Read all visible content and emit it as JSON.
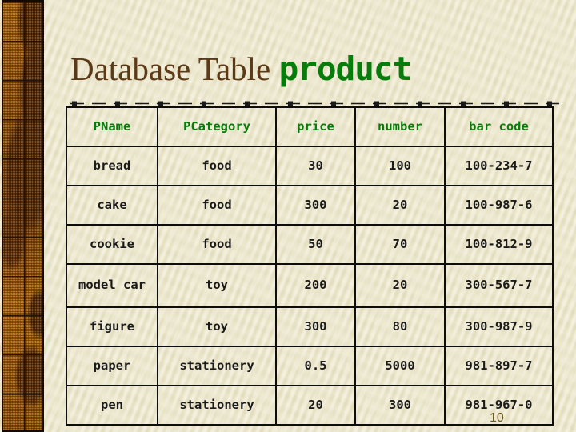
{
  "slide": {
    "background_color": "#efead0",
    "page_number": "10"
  },
  "decoration": {
    "left_band_name": "textured-brown-border",
    "band_colors": [
      "#a9661d",
      "#4a2a16",
      "#120b04"
    ],
    "dashed_rule_color": "#1a1a1a"
  },
  "title": {
    "prefix": "Database Table ",
    "entity": "product",
    "prefix_color": "#5c3a17",
    "entity_color": "#067d0b"
  },
  "table": {
    "header_color": "#067d0b",
    "body_color": "#1a1a1a",
    "border_color": "#0d0d0d",
    "columns": [
      "PName",
      "PCategory",
      "price",
      "number",
      "bar code"
    ],
    "rows": [
      [
        "bread",
        "food",
        "30",
        "100",
        "100-234-7"
      ],
      [
        "cake",
        "food",
        "300",
        "20",
        "100-987-6"
      ],
      [
        "cookie",
        "food",
        "50",
        "70",
        "100-812-9"
      ],
      [
        "model car",
        "toy",
        "200",
        "20",
        "300-567-7"
      ],
      [
        "figure",
        "toy",
        "300",
        "80",
        "300-987-9"
      ],
      [
        "paper",
        "stationery",
        "0.5",
        "5000",
        "981-897-7"
      ],
      [
        "pen",
        "stationery",
        "20",
        "300",
        "981-967-0"
      ]
    ]
  }
}
